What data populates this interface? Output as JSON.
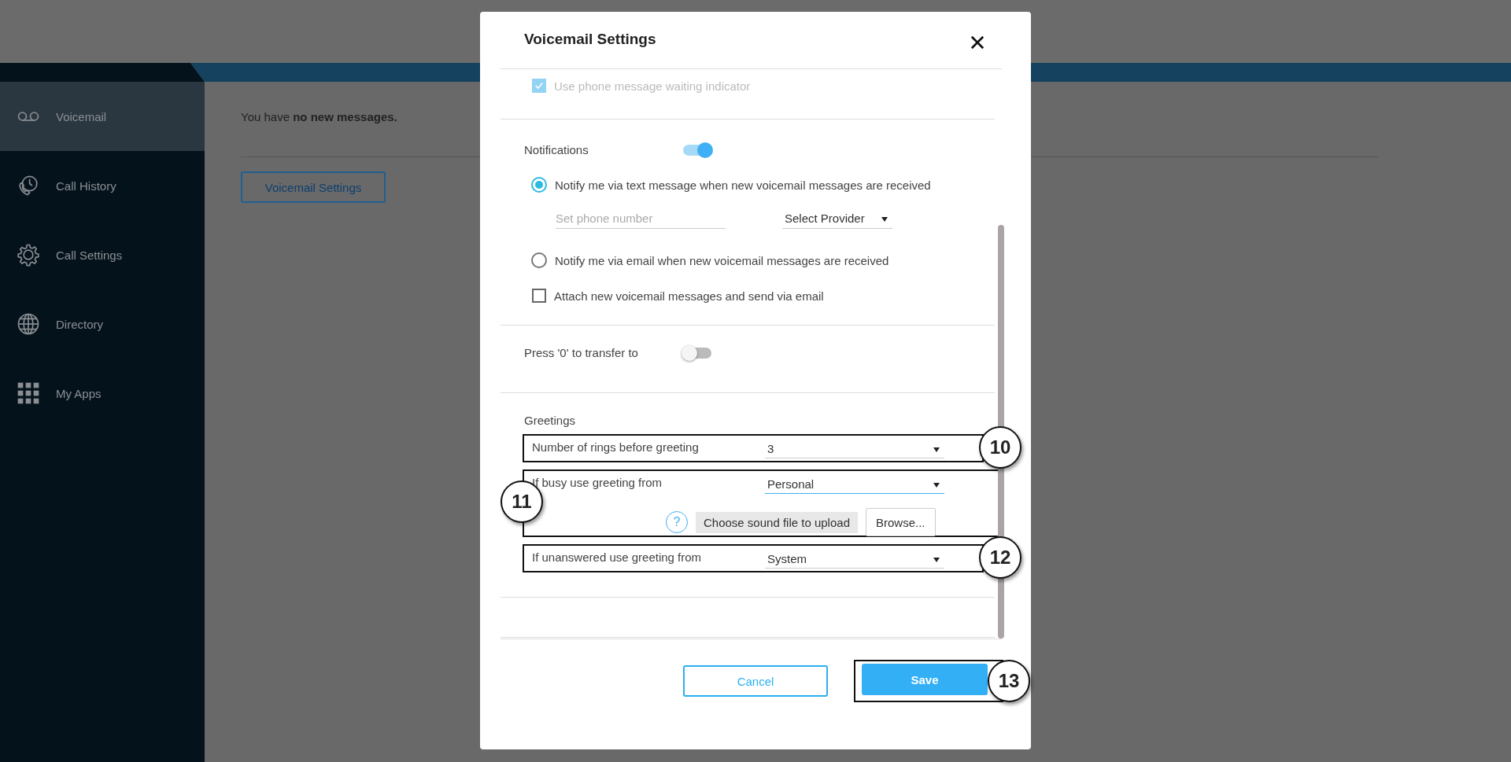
{
  "sidebar": {
    "items": [
      {
        "label": "Voicemail",
        "selected": true
      },
      {
        "label": "Call History",
        "selected": false
      },
      {
        "label": "Call Settings",
        "selected": false
      },
      {
        "label": "Directory",
        "selected": false
      },
      {
        "label": "My Apps",
        "selected": false
      }
    ]
  },
  "main": {
    "message": "You have **no new messages.**",
    "button": "Voicemail Settings"
  },
  "dialog": {
    "title": "Voicemail Settings",
    "mwi": {
      "label": "Use phone message waiting indicator",
      "checked": true,
      "disabled": true
    },
    "notifications": {
      "label": "Notifications",
      "on": true,
      "options": [
        {
          "label": "Notify me via text message when new voicemail messages are received",
          "selected": true,
          "phone_placeholder": "Set phone number",
          "provider": "Select Provider"
        },
        {
          "label": "Notify me via email when new voicemail messages are received",
          "selected": false
        }
      ],
      "attach": {
        "label": "Attach new voicemail messages and send via email",
        "checked": false
      }
    },
    "transfer": {
      "label": "Press '0' to transfer to",
      "on": false
    },
    "greetings": {
      "heading": "Greetings",
      "rows": [
        {
          "label": "Number of rings before greeting",
          "value": "3",
          "focused": false,
          "annotation": "10"
        },
        {
          "label": "If busy use greeting from",
          "value": "Personal",
          "focused": true,
          "annotation": "11",
          "upload": {
            "hint": "?",
            "file": "Choose sound file to upload",
            "browse": "Browse..."
          }
        },
        {
          "label": "If unanswered use greeting from",
          "value": "System",
          "focused": false,
          "annotation": "12"
        }
      ]
    },
    "cancel": "Cancel",
    "save": "Save",
    "save_annotation": "13"
  }
}
